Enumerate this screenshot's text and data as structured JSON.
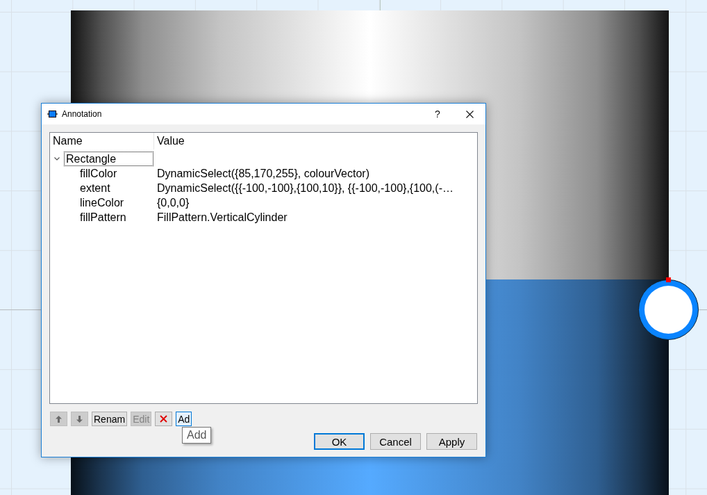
{
  "dialog": {
    "title": "Annotation",
    "help_button": "?"
  },
  "tree": {
    "columns": [
      "Name",
      "Value"
    ],
    "items": [
      {
        "name": "Rectangle",
        "expanded": true,
        "selected": true,
        "children": [
          {
            "name": "fillColor",
            "value": "DynamicSelect({85,170,255}, colourVector)",
            "selected": false
          },
          {
            "name": "extent",
            "value": "DynamicSelect({{-100,-100},{100,10}}, {{-100,-100},{100,(-…",
            "selected": false
          },
          {
            "name": "lineColor",
            "value": "{0,0,0}",
            "selected": false
          },
          {
            "name": "fillPattern",
            "value": "FillPattern.VerticalCylinder",
            "selected": false
          }
        ]
      }
    ]
  },
  "toolbar": [
    {
      "kind": "up",
      "disabled": true,
      "focused": false
    },
    {
      "kind": "down",
      "disabled": true,
      "focused": false
    },
    {
      "kind": "text",
      "label": "Renam",
      "disabled": false,
      "focused": false
    },
    {
      "kind": "text",
      "label": "Edit",
      "disabled": true,
      "focused": false
    },
    {
      "kind": "delete",
      "disabled": false,
      "focused": false
    },
    {
      "kind": "text",
      "label": "Ad",
      "disabled": false,
      "focused": true
    }
  ],
  "tooltip": "Add",
  "buttons": [
    {
      "label": "OK",
      "default": true
    },
    {
      "label": "Cancel",
      "default": false
    },
    {
      "label": "Apply",
      "default": false
    }
  ]
}
